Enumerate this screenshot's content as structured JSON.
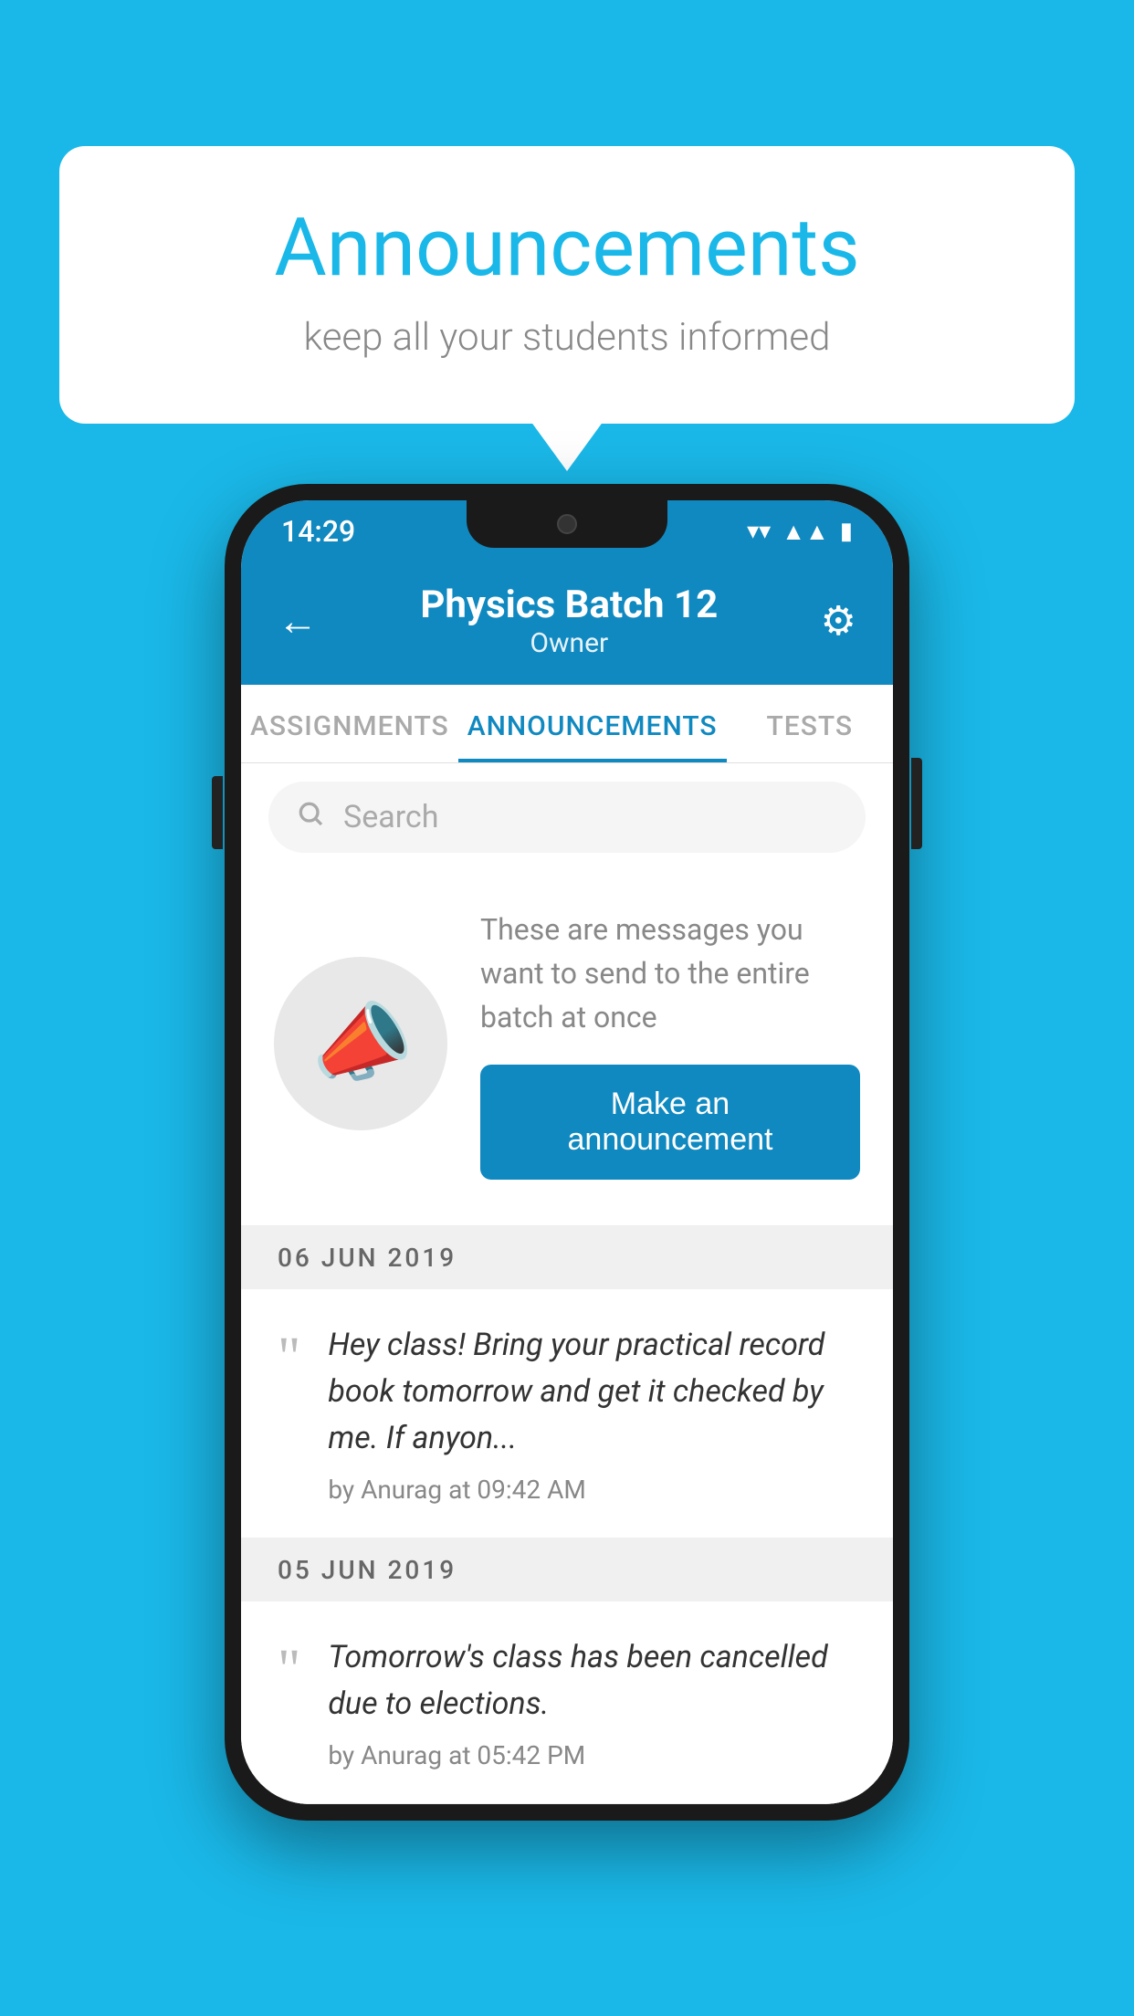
{
  "background": {
    "color": "#1ab8e8"
  },
  "speech_bubble": {
    "title": "Announcements",
    "subtitle": "keep all your students informed"
  },
  "phone": {
    "status_bar": {
      "time": "14:29",
      "icons": [
        "wifi",
        "signal",
        "battery"
      ]
    },
    "header": {
      "title": "Physics Batch 12",
      "subtitle": "Owner",
      "back_label": "←",
      "gear_label": "⚙"
    },
    "tabs": [
      {
        "label": "ASSIGNMENTS",
        "active": false
      },
      {
        "label": "ANNOUNCEMENTS",
        "active": true
      },
      {
        "label": "TESTS",
        "active": false
      }
    ],
    "search": {
      "placeholder": "Search"
    },
    "promo": {
      "description": "These are messages you want to send to the entire batch at once",
      "button_label": "Make an announcement"
    },
    "announcements": [
      {
        "date": "06  JUN  2019",
        "text": "Hey class! Bring your practical record book tomorrow and get it checked by me. If anyon...",
        "meta": "by Anurag at 09:42 AM"
      },
      {
        "date": "05  JUN  2019",
        "text": "Tomorrow's class has been cancelled due to elections.",
        "meta": "by Anurag at 05:42 PM"
      }
    ]
  }
}
